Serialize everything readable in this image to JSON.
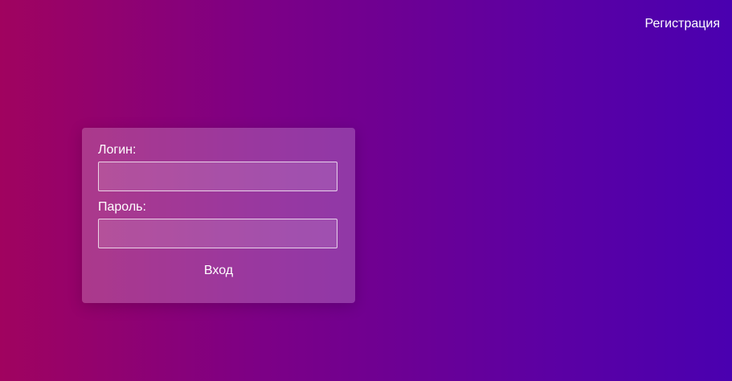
{
  "header": {
    "register_label": "Регистрация"
  },
  "login_form": {
    "login_label": "Логин:",
    "login_value": "",
    "password_label": "Пароль:",
    "password_value": "",
    "submit_label": "Вход"
  },
  "colors": {
    "gradient_left": "#a0035f",
    "gradient_right": "#4a00b0",
    "text": "#ffffff"
  }
}
